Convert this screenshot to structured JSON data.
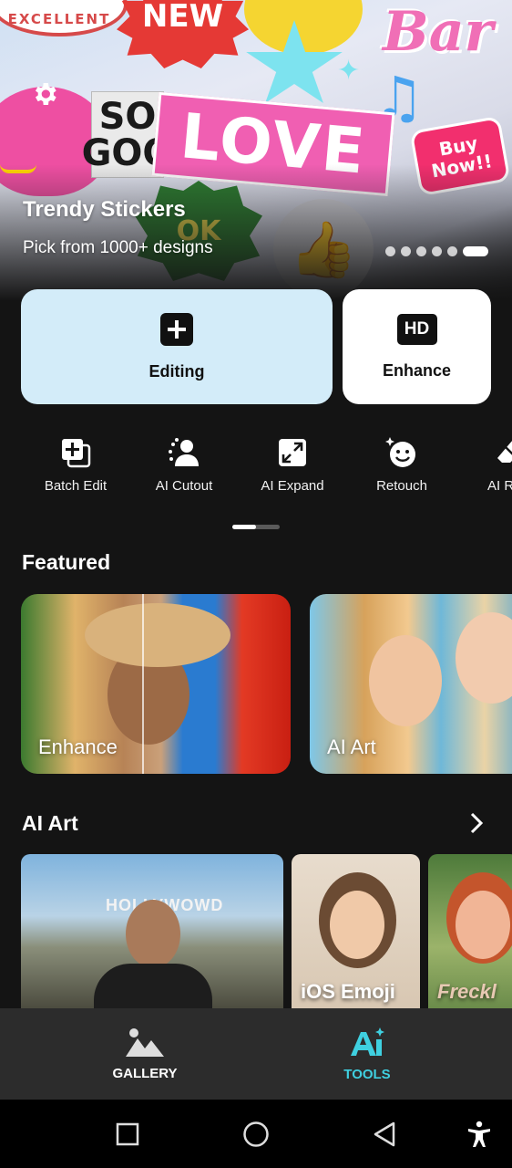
{
  "hero": {
    "title": "Trendy Stickers",
    "subtitle": "Pick from 1000+ designs",
    "stickers": {
      "badge": "EXCELLENT",
      "new": "NEW",
      "barbie": "Bar",
      "so_good_line1": "SO",
      "so_good_line2": "GOO",
      "love": "LOVE",
      "buy_now": "Buy Now!!",
      "ok": "OK"
    },
    "carousel_count": 6,
    "carousel_active": 5
  },
  "actions": {
    "editing_label": "Editing",
    "enhance_label": "Enhance",
    "enhance_icon_text": "HD"
  },
  "tools": [
    {
      "label": "Batch Edit",
      "icon": "batch-edit-icon"
    },
    {
      "label": "AI Cutout",
      "icon": "ai-cutout-icon"
    },
    {
      "label": "AI Expand",
      "icon": "ai-expand-icon"
    },
    {
      "label": "Retouch",
      "icon": "retouch-icon"
    },
    {
      "label": "AI Rem",
      "icon": "eraser-icon"
    }
  ],
  "featured": {
    "title": "Featured",
    "cards": [
      {
        "label": "Enhance"
      },
      {
        "label": "AI Art"
      }
    ]
  },
  "ai_art": {
    "title": "AI Art",
    "cards": [
      {
        "label": "",
        "sign": "HOLLYWOWD"
      },
      {
        "label": "iOS Emoji"
      },
      {
        "label": "Freckl"
      }
    ]
  },
  "bottom_nav": {
    "gallery": "GALLERY",
    "tools": "TOOLS"
  },
  "colors": {
    "accent": "#3fd0e0",
    "editing_card": "#d3ecf9",
    "background": "#141414",
    "nav_bg": "#2c2c2c"
  }
}
